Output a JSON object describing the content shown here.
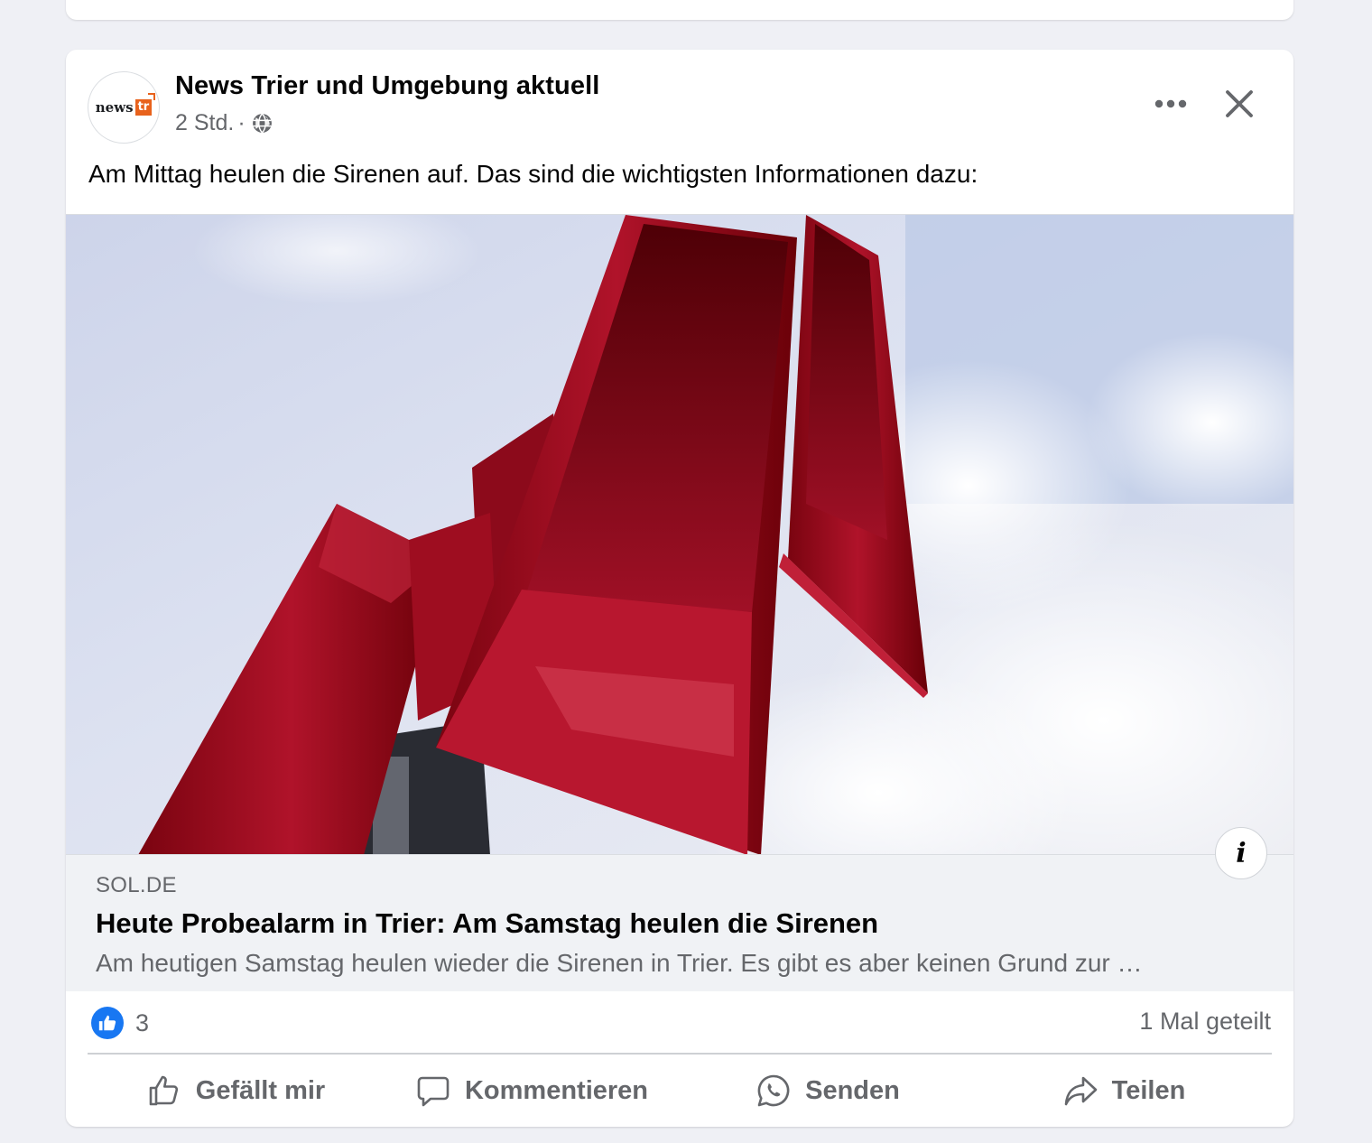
{
  "post": {
    "page_name": "News Trier und Umgebung aktuell",
    "time": "2 Std.",
    "separator": "·",
    "text": "Am Mittag heulen die Sirenen auf. Das sind die wichtigsten Informationen dazu:",
    "avatar_logo": {
      "part1": "news",
      "part2": "tr"
    }
  },
  "link": {
    "domain": "SOL.DE",
    "title": "Heute Probealarm in Trier: Am Samstag heulen die Sirenen",
    "description": "Am heutigen Samstag heulen wieder die Sirenen in Trier. Es gibt es aber keinen Grund zur …",
    "info_label": "i"
  },
  "stats": {
    "reaction_count": "3",
    "shares": "1 Mal geteilt"
  },
  "actions": {
    "like": "Gefällt mir",
    "comment": "Kommentieren",
    "send": "Senden",
    "share": "Teilen"
  },
  "icons": {
    "globe": "globe-icon",
    "more": "more-options-icon",
    "close": "close-icon",
    "like": "thumbs-up-icon",
    "comment": "comment-bubble-icon",
    "send": "whatsapp-icon",
    "share": "share-arrow-icon"
  },
  "colors": {
    "brand_blue": "#1877f2",
    "logo_orange": "#e8621c",
    "siren_red": "#a0101e",
    "secondary_text": "#65676b"
  }
}
